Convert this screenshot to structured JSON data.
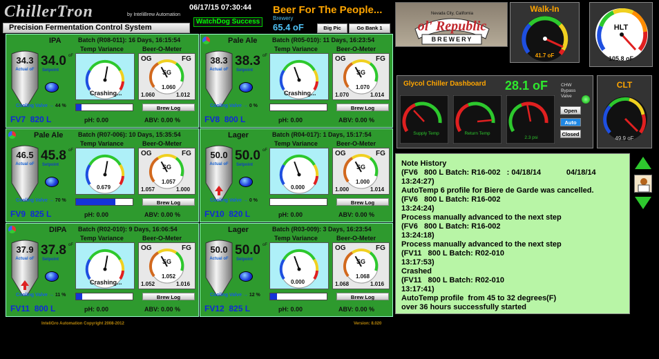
{
  "header": {
    "app_title": "ChillerTron",
    "by_line": "by InteliBrew Automation",
    "subtitle": "Precision Fermentation Control System",
    "datetime": "06/17/15 07:30:44",
    "watchdog": "WatchDog Success",
    "slogan": "Beer For The People...",
    "brewery_label": "Brewery",
    "brewery_temp": "65.4 oF",
    "big_pic_label": "Big Pic",
    "go_bank_label": "Go Bank 1"
  },
  "brand": {
    "small": "Nevada City, California",
    "name": "ol' Republic",
    "sub": "BREWERY"
  },
  "walkin": {
    "title": "Walk-In",
    "value": "41.7 oF"
  },
  "hlt": {
    "title": "HLT",
    "value": "105.8 oF"
  },
  "glycol": {
    "title": "Glycol Chiller Dashboard",
    "temp": "28.1 oF",
    "chw_label": "CHW Bypass Valve",
    "supply": "Supply Temp",
    "return": "Return Temp",
    "psi": "2.3 psi",
    "open": "Open",
    "auto": "Auto",
    "closed": "Closed"
  },
  "clt": {
    "title": "CLT",
    "value": "49.9 oF"
  },
  "labels": {
    "actual": "Actual oF",
    "setpoint": "Setpoint",
    "cooling_valve": "Cooling Valve",
    "temp_variance": "Temp Variance",
    "beer_o_meter": "Beer-O-Meter",
    "og": "OG",
    "fg": "FG",
    "sg": "SG",
    "brew_log": "Brew Log",
    "arrow": "→",
    "of": "oF"
  },
  "fermenters": [
    {
      "style": "IPA",
      "batch": "Batch (R08-011): 16 Days, 16:15:54",
      "actual": "34.3",
      "setpoint": "34.0",
      "valve_pct": "44 %",
      "valve_fill": 0.1,
      "variance": "",
      "status": "Crashing...",
      "sg": "1.060",
      "og": "1.060",
      "fg": "1.012",
      "fv": "FV7",
      "vol": "820 L",
      "ph": "pH: 0.00",
      "abv": "ABV: 0.00 %",
      "tank_arrow": false,
      "dots": false
    },
    {
      "style": "Pale Ale",
      "batch": "Batch (R05-010): 11 Days, 16:23:54",
      "actual": "38.3",
      "setpoint": "38.3",
      "valve_pct": "0 %",
      "valve_fill": 0,
      "variance": "",
      "status": "Crashing...",
      "sg": "1.070",
      "og": "1.070",
      "fg": "1.014",
      "fv": "FV8",
      "vol": "800 L",
      "ph": "pH: 0.00",
      "abv": "ABV: 0.00 %",
      "tank_arrow": false,
      "dots": true
    },
    {
      "style": "Pale Ale",
      "batch": "Batch (R07-006): 10 Days, 15:35:54",
      "actual": "46.5",
      "setpoint": "45.8",
      "valve_pct": "70 %",
      "valve_fill": 0.7,
      "variance": "0.679",
      "status": "",
      "sg": "1.057",
      "og": "1.057",
      "fg": "1.000",
      "fv": "FV9",
      "vol": "825 L",
      "ph": "pH: 0.00",
      "abv": "ABV: 0.00 %",
      "tank_arrow": false,
      "dots": true
    },
    {
      "style": "Lager",
      "batch": "Batch (R04-017): 1 Days, 15:17:54",
      "actual": "50.0",
      "setpoint": "50.0",
      "valve_pct": "0 %",
      "valve_fill": 0,
      "variance": "0.000",
      "status": "",
      "sg": "1.000",
      "og": "1.000",
      "fg": "1.014",
      "fv": "FV10",
      "vol": "820 L",
      "ph": "pH: 0.00",
      "abv": "ABV: 0.00 %",
      "tank_arrow": true,
      "dots": false
    },
    {
      "style": "DIPA",
      "batch": "Batch (R02-010): 9 Days, 16:06:54",
      "actual": "37.9",
      "setpoint": "37.8",
      "valve_pct": "11 %",
      "valve_fill": 0.11,
      "variance": "",
      "status": "Crashing...",
      "sg": "1.052",
      "og": "1.052",
      "fg": "1.016",
      "fv": "FV11",
      "vol": "800 L",
      "ph": "pH: 0.00",
      "abv": "ABV: 0.00 %",
      "tank_arrow": true,
      "dots": true
    },
    {
      "style": "Lager",
      "batch": "Batch (R03-009): 3 Days, 16:23:54",
      "actual": "50.0",
      "setpoint": "50.0",
      "valve_pct": "12 %",
      "valve_fill": 0.12,
      "variance": "0.000",
      "status": "",
      "sg": "1.068",
      "og": "1.068",
      "fg": "1.016",
      "fv": "FV12",
      "vol": "825 L",
      "ph": "pH: 0.00",
      "abv": "ABV: 0.00 %",
      "tank_arrow": false,
      "dots": false
    }
  ],
  "notes": {
    "lines": [
      "Note History",
      "(FV6   800 L Batch: R16-002   : 04/18/14            04/18/14",
      "13:24:27)",
      "AutoTemp 6 profile for Biere de Garde was cancelled.",
      "(FV6   800 L Batch: R16-002",
      "13:24:24)",
      "Process manually advanced to the next step",
      "(FV6   800 L Batch: R16-002",
      "13:24:18)",
      "Process manually advanced to the next step",
      "(FV11   800 L Batch: R02-010",
      "13:17:53)",
      "Crashed",
      "(FV11   800 L Batch: R02-010",
      "13:17:41)",
      "AutoTemp profile  from 45 to 32 degrees(F)",
      "over 36 hours successfully started"
    ]
  },
  "footer": {
    "copyright": "InteliGro Automation  Copyright 2008-2012",
    "version": "Version: 8.020"
  },
  "colors": {
    "panel": "#2e9a2e",
    "notes_bg": "#b8f5a6",
    "accent": "#ffa500"
  }
}
